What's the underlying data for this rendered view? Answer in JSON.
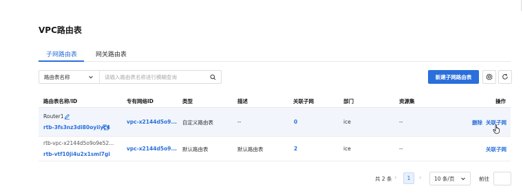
{
  "page_title": "VPC路由表",
  "tabs": [
    {
      "label": "子网路由表",
      "active": true
    },
    {
      "label": "网关路由表",
      "active": false
    }
  ],
  "filter": {
    "field": "路由表名称",
    "placeholder": "请输入路由表名称进行模糊查询"
  },
  "toolbar": {
    "create_label": "新建子网路由表",
    "settings_icon": "gear-icon",
    "refresh_icon": "refresh-icon"
  },
  "table": {
    "columns": [
      "路由表名称/ID",
      "专有网络ID",
      "类型",
      "描述",
      "关联子网",
      "部门",
      "资源集",
      "操作"
    ],
    "rows": [
      {
        "name": "Router1",
        "id": "rtb-3fs3nz3di80oyiiyc4",
        "vpc": "vpc-x2144d5o9...",
        "type": "自定义路由表",
        "desc": "--",
        "subnets": "0",
        "dept": "ice",
        "resource": "--",
        "actions": [
          "删除",
          "关联子网"
        ]
      },
      {
        "name": "rtb-vpc-x2144d5o9o9e52...",
        "id": "rtb-vtf10ji4u2x1sml7gi",
        "vpc": "vpc-x2144d5o9...",
        "type": "默认路由表",
        "desc": "默认路由表",
        "subnets": "2",
        "dept": "ice",
        "resource": "--",
        "actions": [
          "关联子网"
        ]
      }
    ]
  },
  "pagination": {
    "total": "共 2 条",
    "current_page": "1",
    "page_size": "10 条/页",
    "goto_label": "前往"
  },
  "colors": {
    "primary": "#2a6fdb",
    "row_hover": "#f2f6fc"
  }
}
